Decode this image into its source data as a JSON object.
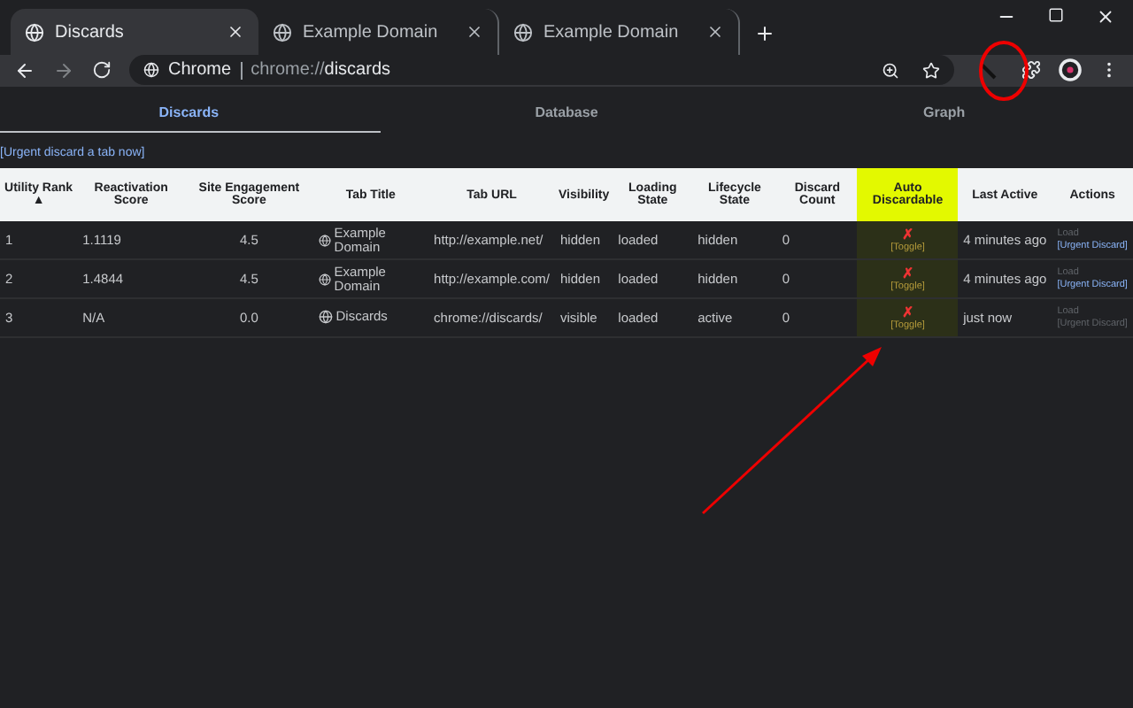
{
  "window": {
    "tabs": [
      {
        "title": "Discards",
        "selected": true
      },
      {
        "title": "Example Domain",
        "selected": false
      },
      {
        "title": "Example Domain",
        "selected": false
      }
    ]
  },
  "toolbar": {
    "site_label": "Chrome",
    "url_scheme": "chrome://",
    "url_host": "discards"
  },
  "page_tabs": [
    {
      "label": "Discards",
      "selected": true
    },
    {
      "label": "Database",
      "selected": false
    },
    {
      "label": "Graph",
      "selected": false
    }
  ],
  "urgent_link": "[Urgent discard a tab now]",
  "table": {
    "columns": [
      {
        "label": "Utility Rank",
        "sort_indicator": "▲",
        "highlighted": false
      },
      {
        "label": "Reactivation Score",
        "highlighted": false
      },
      {
        "label": "Site Engagement Score",
        "highlighted": false
      },
      {
        "label": "Tab Title",
        "highlighted": false
      },
      {
        "label": "Tab URL",
        "highlighted": false
      },
      {
        "label": "Visibility",
        "highlighted": false
      },
      {
        "label": "Loading State",
        "highlighted": false
      },
      {
        "label": "Lifecycle State",
        "highlighted": false
      },
      {
        "label": "Discard Count",
        "highlighted": false
      },
      {
        "label": "Auto Discardable",
        "highlighted": true
      },
      {
        "label": "Last Active",
        "highlighted": false
      },
      {
        "label": "Actions",
        "highlighted": false
      }
    ],
    "rows": [
      {
        "rank": "1",
        "reactivation": "1.1119",
        "engagement": "4.5",
        "title": "Example Domain",
        "url": "http://example.net/",
        "visibility": "hidden",
        "loading": "loaded",
        "lifecycle": "hidden",
        "discards": "0",
        "auto_mark": "✗",
        "toggle": "[Toggle]",
        "last_active": "4 minutes ago",
        "load": {
          "label": "Load",
          "disabled": true
        },
        "urgent": {
          "label": "[Urgent Discard]",
          "disabled": false
        }
      },
      {
        "rank": "2",
        "reactivation": "1.4844",
        "engagement": "4.5",
        "title": "Example Domain",
        "url": "http://example.com/",
        "visibility": "hidden",
        "loading": "loaded",
        "lifecycle": "hidden",
        "discards": "0",
        "auto_mark": "✗",
        "toggle": "[Toggle]",
        "last_active": "4 minutes ago",
        "load": {
          "label": "Load",
          "disabled": true
        },
        "urgent": {
          "label": "[Urgent Discard]",
          "disabled": false
        }
      },
      {
        "rank": "3",
        "reactivation": "N/A",
        "engagement": "0.0",
        "title": "Discards",
        "url": "chrome://discards/",
        "visibility": "visible",
        "loading": "loaded",
        "lifecycle": "active",
        "discards": "0",
        "auto_mark": "✗",
        "toggle": "[Toggle]",
        "last_active": "just now",
        "load": {
          "label": "Load",
          "disabled": true
        },
        "urgent": {
          "label": "[Urgent Discard]",
          "disabled": true
        }
      }
    ]
  }
}
